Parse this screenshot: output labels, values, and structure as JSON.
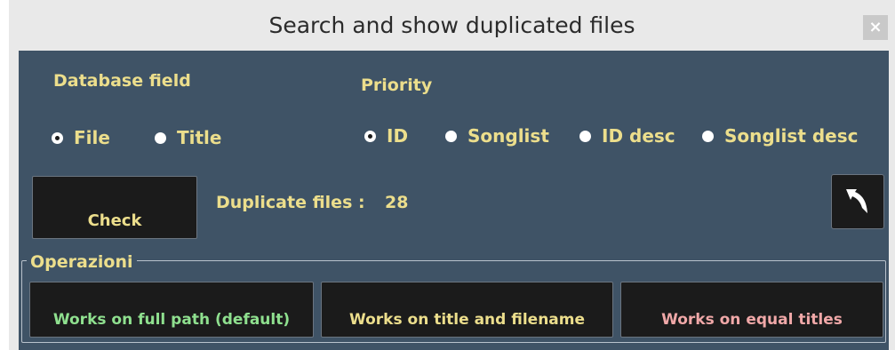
{
  "window": {
    "title": "Search and show duplicated files",
    "close_label": "×"
  },
  "database_field": {
    "label": "Database field",
    "options": [
      {
        "label": "File",
        "checked": true
      },
      {
        "label": "Title",
        "checked": false
      }
    ]
  },
  "priority": {
    "label": "Priority",
    "options": [
      {
        "label": "ID",
        "checked": true
      },
      {
        "label": "Songlist",
        "checked": false
      },
      {
        "label": "ID desc",
        "checked": false
      },
      {
        "label": "Songlist desc",
        "checked": false
      }
    ]
  },
  "check_button": {
    "label": "Check"
  },
  "duplicates": {
    "label": "Duplicate files :",
    "count": "28"
  },
  "back_button": {
    "icon": "back-arrow-icon"
  },
  "operations": {
    "group_title": "Operazioni",
    "buttons": [
      {
        "label": "Works on full path (default)",
        "color": "#8fe08f"
      },
      {
        "label": "Works on title and filename",
        "color": "#ecde8c"
      },
      {
        "label": "Works on equal titles",
        "color": "#f0a8a8"
      }
    ]
  },
  "colors": {
    "panel": "#3f5366",
    "button": "#1b1b1b",
    "text": "#ecde8c"
  }
}
